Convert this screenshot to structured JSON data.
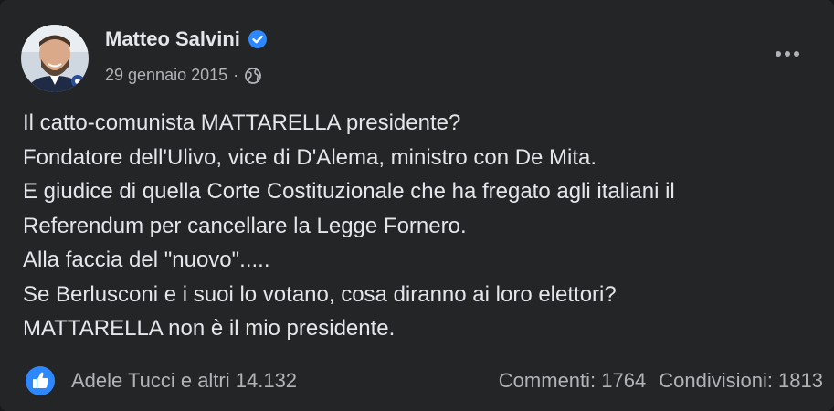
{
  "post": {
    "author": "Matteo Salvini",
    "date": "29 gennaio 2015",
    "separator": "·",
    "icons": {
      "verified": "verified-badge-icon",
      "audience": "globe-icon",
      "menu": "more-options-icon",
      "reaction": "like-icon"
    },
    "text_lines": [
      "Il catto-comunista MATTARELLA presidente?",
      "Fondatore dell'Ulivo, vice di D'Alema, ministro con De Mita.",
      "E giudice di quella Corte Costituzionale che ha fregato agli italiani il",
      "Referendum per cancellare la Legge Fornero.",
      "Alla faccia del \"nuovo\".....",
      "Se Berlusconi e i suoi lo votano, cosa diranno ai loro elettori?",
      "MATTARELLA non è il mio presidente."
    ]
  },
  "footer": {
    "reactions": "Adele Tucci e altri 14.132",
    "comments": "Commenti: 1764",
    "shares": "Condivisioni: 1813"
  },
  "colors": {
    "background": "#242526",
    "primary_text": "#e4e6eb",
    "secondary_text": "#b0b3b8",
    "accent": "#2d88ff"
  }
}
